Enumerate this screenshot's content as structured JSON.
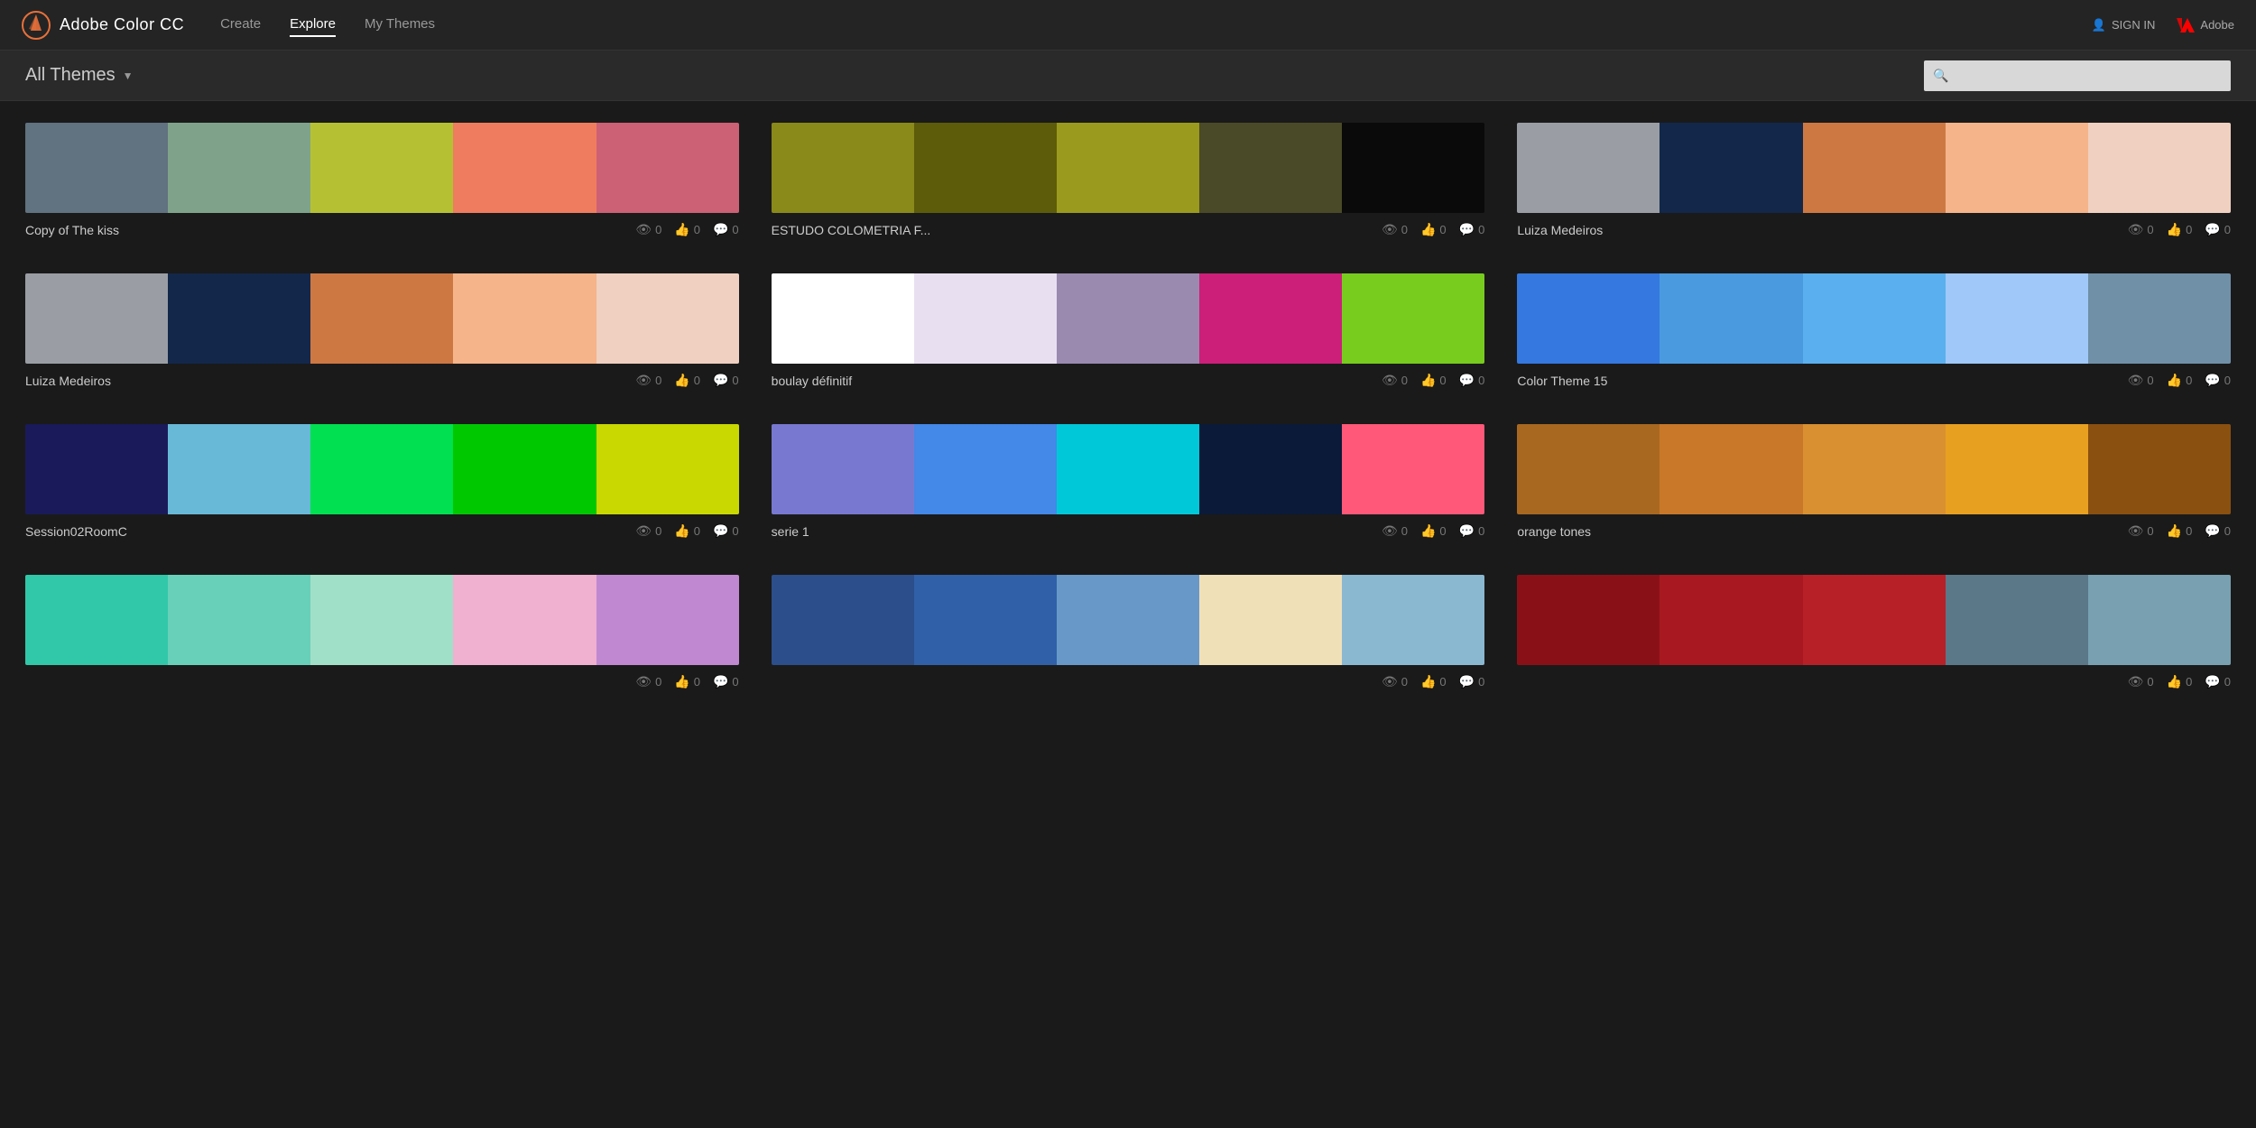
{
  "app": {
    "name": "Adobe Color CC",
    "logo_text": "Ac"
  },
  "header": {
    "nav": [
      {
        "label": "Create",
        "active": false
      },
      {
        "label": "Explore",
        "active": true
      },
      {
        "label": "My Themes",
        "active": false
      }
    ],
    "sign_in_label": "SIGN IN",
    "adobe_label": "Adobe"
  },
  "toolbar": {
    "all_themes_label": "All Themes",
    "search_placeholder": ""
  },
  "themes": [
    {
      "title": "Copy of The kiss",
      "views": "0",
      "likes": "0",
      "comments": "0",
      "colors": [
        "#617280",
        "#7fa38a",
        "#b5c132",
        "#ef7c5e",
        "#cc6075"
      ]
    },
    {
      "title": "ESTUDO COLOMETRIA F...",
      "views": "0",
      "likes": "0",
      "comments": "0",
      "colors": [
        "#8a8a1a",
        "#5c5c0a",
        "#9a9a1e",
        "#4a4a28",
        "#0a0a0a"
      ]
    },
    {
      "title": "Luiza Medeiros",
      "views": "0",
      "likes": "0",
      "comments": "0",
      "colors": [
        "#9a9ea4",
        "#12274a",
        "#cd7843",
        "#f5b48a",
        "#f0d0c0"
      ]
    },
    {
      "title": "Luiza Medeiros",
      "views": "0",
      "likes": "0",
      "comments": "0",
      "colors": [
        "#9a9ea4",
        "#12274a",
        "#cd7843",
        "#f5b48a",
        "#f0d0c0"
      ]
    },
    {
      "title": "boulay définitif",
      "views": "0",
      "likes": "0",
      "comments": "0",
      "colors": [
        "#ffffff",
        "#e8e0f0",
        "#9a8ab0",
        "#cc1f7a",
        "#78cc1e"
      ]
    },
    {
      "title": "Color Theme 15",
      "views": "0",
      "likes": "0",
      "comments": "0",
      "colors": [
        "#3478e0",
        "#4a9ae0",
        "#5ab0ee",
        "#a0c8f8",
        "#7090a8"
      ]
    },
    {
      "title": "Session02RoomC",
      "views": "0",
      "likes": "0",
      "comments": "0",
      "colors": [
        "#1a1a5a",
        "#68b8d8",
        "#00e050",
        "#00c800",
        "#c8d800"
      ]
    },
    {
      "title": "serie 1",
      "views": "0",
      "likes": "0",
      "comments": "0",
      "colors": [
        "#7878d0",
        "#4488e8",
        "#00c8d8",
        "#0a1a38",
        "#ff5878"
      ]
    },
    {
      "title": "orange tones",
      "views": "0",
      "likes": "0",
      "comments": "0",
      "colors": [
        "#a86820",
        "#c87828",
        "#d89030",
        "#e8a020",
        "#8a5010"
      ]
    },
    {
      "title": "",
      "views": "0",
      "likes": "0",
      "comments": "0",
      "colors": [
        "#30c8a8",
        "#68d0b8",
        "#a0e0c8",
        "#f0b0d0",
        "#c088d0"
      ]
    },
    {
      "title": "",
      "views": "0",
      "likes": "0",
      "comments": "0",
      "colors": [
        "#2c4e8a",
        "#3060a8",
        "#6898c8",
        "#f0e0b8",
        "#8ab8d0"
      ]
    },
    {
      "title": "",
      "views": "0",
      "likes": "0",
      "comments": "0",
      "colors": [
        "#8a1018",
        "#a81820",
        "#b82028",
        "#5a7888",
        "#78a0b0"
      ]
    }
  ]
}
